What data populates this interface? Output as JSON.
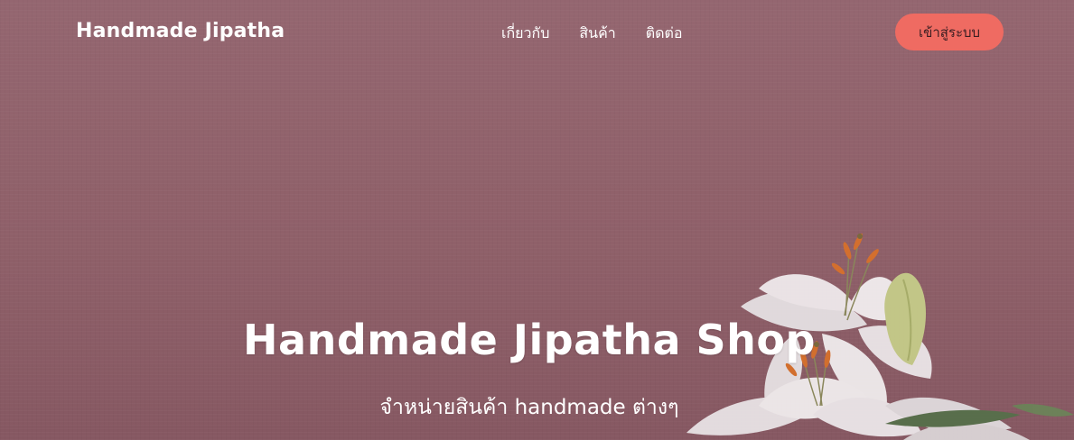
{
  "navbar": {
    "brand": "Handmade Jipatha",
    "links": [
      "เกี่ยวกับ",
      "สินค้า",
      "ติดต่อ"
    ],
    "login_label": "เข้าสู่ระบบ"
  },
  "hero": {
    "title": "Handmade Jipatha Shop",
    "subtitle": "จำหน่ายสินค้า handmade ต่างๆ",
    "background_image": "white-lily-flowers"
  },
  "colors": {
    "background": "#946670",
    "login_button": "#ef6b62",
    "text": "#ffffff"
  }
}
